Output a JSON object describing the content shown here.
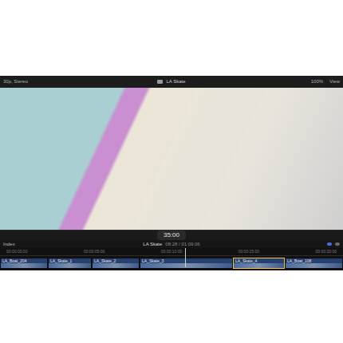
{
  "viewer": {
    "format": "30p, Stereo",
    "title": "LA Skate",
    "zoom": "100%",
    "view": "View"
  },
  "toolbar": {
    "timecode": "35:00"
  },
  "timeline": {
    "index": "Index",
    "project": "LA Skate",
    "duration": "08:28 / 01:09:06",
    "ruler": [
      "00:00:00:00",
      "00:00:05:00",
      "00:00:10:00",
      "00:00:15:00",
      "00:00:20:00"
    ],
    "clips": [
      {
        "name": "LA_Boat_204",
        "selected": false
      },
      {
        "name": "LA_Skate_1",
        "selected": false
      },
      {
        "name": "LA_Skate_2",
        "selected": false
      },
      {
        "name": "LA_Skate_3",
        "selected": false
      },
      {
        "name": "LA_Skate_4",
        "selected": true
      },
      {
        "name": "LA_Boat_108",
        "selected": false
      }
    ]
  }
}
